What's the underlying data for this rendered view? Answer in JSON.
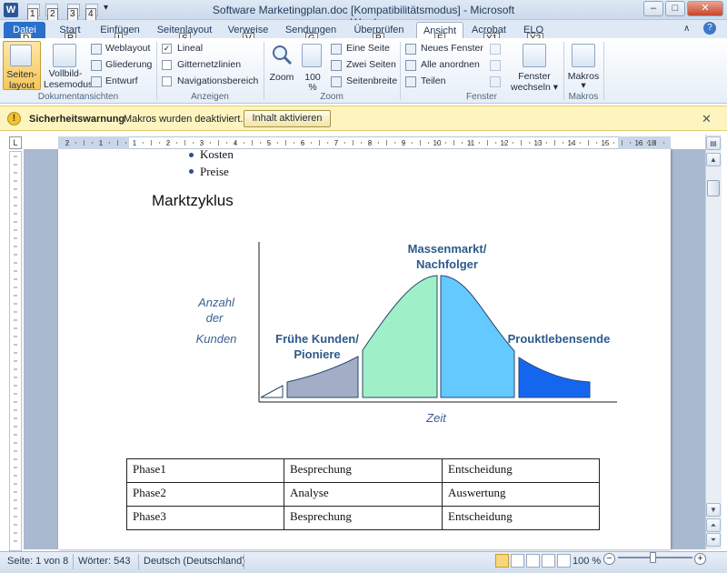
{
  "window": {
    "title": "Software Marketingplan.doc [Kompatibilitätsmodus]  -  Microsoft Word",
    "app_icon": "W",
    "qat_keytips": [
      "1",
      "2",
      "3",
      "4"
    ],
    "controls": {
      "minimize": "–",
      "maximize": "□",
      "close": "✕"
    }
  },
  "tabs": [
    {
      "label": "Datei",
      "keytip": "D"
    },
    {
      "label": "Start",
      "keytip": "R"
    },
    {
      "label": "Einfügen",
      "keytip": "I"
    },
    {
      "label": "Seitenlayout",
      "keytip": "S"
    },
    {
      "label": "Verweise",
      "keytip": "V"
    },
    {
      "label": "Sendungen",
      "keytip": "G"
    },
    {
      "label": "Überprüfen",
      "keytip": "P"
    },
    {
      "label": "Ansicht",
      "keytip": "F"
    },
    {
      "label": "Acrobat",
      "keytip": "Y1"
    },
    {
      "label": "ELO",
      "keytip": "Y2"
    }
  ],
  "ribbon": {
    "dokumentansichten": {
      "label": "Dokumentansichten",
      "seitenlayout": "Seiten-\nlayout",
      "seitenlayout_l1": "Seiten-",
      "seitenlayout_l2": "layout",
      "vollbild_l1": "Vollbild-",
      "vollbild_l2": "Lesemodus",
      "weblayout": "Weblayout",
      "gliederung": "Gliederung",
      "entwurf": "Entwurf"
    },
    "anzeigen": {
      "label": "Anzeigen",
      "lineal": "Lineal",
      "lineal_checked": "✓",
      "gitternetzlinien": "Gitternetzlinien",
      "navigationsbereich": "Navigationsbereich"
    },
    "zoom": {
      "label": "Zoom",
      "zoom": "Zoom",
      "zoom100_l1": "100",
      "zoom100_l2": "%",
      "eine_seite": "Eine Seite",
      "zwei_seiten": "Zwei Seiten",
      "seitenbreite": "Seitenbreite"
    },
    "fenster": {
      "label": "Fenster",
      "neues_fenster": "Neues Fenster",
      "alle_anordnen": "Alle anordnen",
      "teilen": "Teilen",
      "wechseln_l1": "Fenster",
      "wechseln_l2": "wechseln ▾"
    },
    "makros": {
      "label": "Makros",
      "makros": "Makros",
      "arrow": "▾"
    }
  },
  "security_bar": {
    "title": "Sicherheitswarnung",
    "message": "Makros wurden deaktiviert.",
    "button": "Inhalt aktivieren",
    "close": "✕"
  },
  "ruler": {
    "numbers": [
      "2",
      "1",
      "1",
      "2",
      "3",
      "4",
      "5",
      "6",
      "7",
      "8",
      "9",
      "10",
      "11",
      "12",
      "13",
      "14",
      "15",
      "16",
      "18"
    ],
    "corner": "L"
  },
  "document": {
    "bullets": [
      "Kosten",
      "Preise"
    ],
    "heading": "Marktzyklus",
    "diagram": {
      "y_label_1": "Anzahl",
      "y_label_2": "der",
      "y_label_3": "Kunden",
      "x_label": "Zeit",
      "label_early_1": "Frühe Kunden/",
      "label_early_2": "Pioniere",
      "label_mass_1": "Massenmarkt/",
      "label_mass_2": "Nachfolger",
      "label_end": "Prouktlebensende",
      "colors": {
        "pioneer": "#a3aec6",
        "early": "#9ff0c8",
        "mass": "#63c9ff",
        "end": "#1566ef",
        "outline": "#2b4770"
      }
    },
    "table": [
      [
        "Phase1",
        "Besprechung",
        "Entscheidung"
      ],
      [
        "Phase2",
        "Analyse",
        "Auswertung"
      ],
      [
        "Phase3",
        "Besprechung",
        "Entscheidung"
      ]
    ]
  },
  "status_bar": {
    "page": "Seite: 1 von 8",
    "words": "Wörter: 543",
    "language": "Deutsch (Deutschland)",
    "zoom": "100 %",
    "zoom_minus": "−",
    "zoom_plus": "+"
  }
}
